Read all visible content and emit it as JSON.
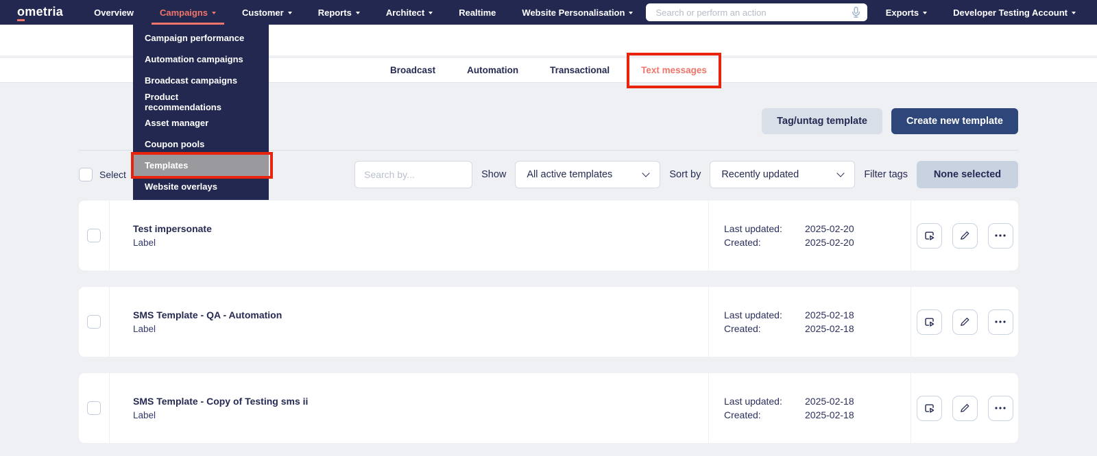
{
  "navbar": {
    "logo_first": "o",
    "logo_rest": "metria",
    "items": [
      "Overview",
      "Campaigns",
      "Customer",
      "Reports",
      "Architect",
      "Realtime",
      "Website Personalisation"
    ],
    "search_placeholder": "Search or perform an action",
    "exports_label": "Exports",
    "account_label": "Developer Testing Account"
  },
  "campaigns_menu": {
    "items": [
      "Campaign performance",
      "Automation campaigns",
      "Broadcast campaigns",
      "Product recommendations",
      "Asset manager",
      "Coupon pools",
      "Templates",
      "Website overlays"
    ],
    "highlighted_item": "Templates"
  },
  "tabs": {
    "items": [
      "Broadcast",
      "Automation",
      "Transactional",
      "Text messages"
    ],
    "active": "Text messages"
  },
  "toolbar": {
    "tag_untag_label": "Tag/untag template",
    "create_label": "Create new template"
  },
  "filters": {
    "select_label": "Select",
    "search_placeholder": "Search by...",
    "show_label": "Show",
    "show_value": "All active templates",
    "sort_label": "Sort by",
    "sort_value": "Recently updated",
    "filter_tags_label": "Filter tags",
    "filter_tags_value": "None selected"
  },
  "table": {
    "date_labels": {
      "updated": "Last updated:",
      "created": "Created:"
    },
    "rows": [
      {
        "title": "Test impersonate",
        "label": "Label",
        "last_updated": "2025-02-20",
        "created": "2025-02-20"
      },
      {
        "title": "SMS Template - QA - Automation",
        "label": "Label",
        "last_updated": "2025-02-18",
        "created": "2025-02-18"
      },
      {
        "title": "SMS Template - Copy of Testing sms ii",
        "label": "Label",
        "last_updated": "2025-02-18",
        "created": "2025-02-18"
      }
    ]
  },
  "colors": {
    "navbar_bg": "#232850",
    "accent_salmon": "#f0756a",
    "annotation_red": "#e8230e",
    "primary_button_bg": "#2e4679",
    "navy_text": "#252a52",
    "page_bg": "#eef0f4",
    "menu_highlight": "#9a9a9e"
  }
}
